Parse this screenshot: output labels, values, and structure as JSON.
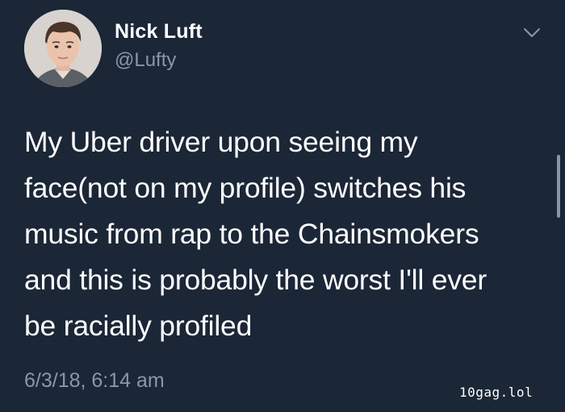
{
  "user": {
    "display_name": "Nick Luft",
    "handle": "@Lufty",
    "avatar_icon": "profile-photo"
  },
  "tweet": {
    "lines": [
      "My Uber driver upon seeing my",
      "face(not on my profile) switches his",
      "music from rap to the Chainsmokers",
      "and this is probably the worst I'll ever",
      "be racially profiled"
    ],
    "timestamp": "6/3/18, 6:14 am"
  },
  "menu": {
    "icon": "chevron-down-icon"
  },
  "watermark": "10gag.lol",
  "colors": {
    "background": "#1b2636",
    "primary_text": "#ffffff",
    "secondary_text": "#8899a6"
  }
}
